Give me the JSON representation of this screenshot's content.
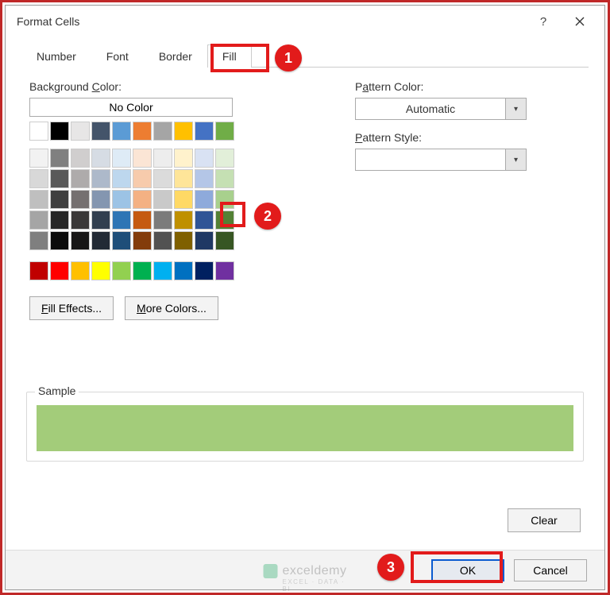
{
  "title": "Format Cells",
  "tabs": {
    "number": "Number",
    "font": "Font",
    "border": "Border",
    "fill": "Fill"
  },
  "bg_label": "Background Color:",
  "bg_label_u": "C",
  "no_color": "No Color",
  "fill_effects": "Fill Effects...",
  "more_colors": "More Colors...",
  "pattern_color_label": "Pattern Color:",
  "pattern_color_value": "Automatic",
  "pattern_style_label": "Pattern Style:",
  "sample_label": "Sample",
  "sample_color": "#a3cc7a",
  "clear": "Clear",
  "ok": "OK",
  "cancel": "Cancel",
  "callouts": {
    "one": "1",
    "two": "2",
    "three": "3"
  },
  "watermark": {
    "name": "exceldemy",
    "tag": "EXCEL · DATA · BI"
  },
  "row1": [
    "#ffffff",
    "#000000",
    "#e7e6e6",
    "#44546a",
    "#5b9bd5",
    "#ed7d31",
    "#a5a5a5",
    "#ffc000",
    "#4472c4",
    "#70ad47"
  ],
  "theme": [
    [
      "#f2f2f2",
      "#808080",
      "#d0cece",
      "#d6dce4",
      "#deebf6",
      "#fbe5d5",
      "#ededed",
      "#fff2cc",
      "#d9e2f3",
      "#e2efd9"
    ],
    [
      "#d8d8d8",
      "#595959",
      "#aeabab",
      "#adb9ca",
      "#bdd7ee",
      "#f7cbac",
      "#dbdbdb",
      "#fee599",
      "#b4c6e7",
      "#c5e0b3"
    ],
    [
      "#bfbfbf",
      "#3f3f3f",
      "#757070",
      "#8496b0",
      "#9cc3e5",
      "#f4b183",
      "#c9c9c9",
      "#ffd965",
      "#8eaadb",
      "#a8d08d"
    ],
    [
      "#a5a5a5",
      "#262626",
      "#3a3838",
      "#323f4f",
      "#2e75b5",
      "#c55a11",
      "#7b7b7b",
      "#bf9000",
      "#2f5496",
      "#538135"
    ],
    [
      "#7f7f7f",
      "#0c0c0c",
      "#171616",
      "#222a35",
      "#1e4e79",
      "#833c0b",
      "#525252",
      "#7f6000",
      "#1f3864",
      "#375623"
    ]
  ],
  "std": [
    "#c00000",
    "#ff0000",
    "#ffc000",
    "#ffff00",
    "#92d050",
    "#00b050",
    "#00b0f0",
    "#0070c0",
    "#002060",
    "#7030a0"
  ]
}
